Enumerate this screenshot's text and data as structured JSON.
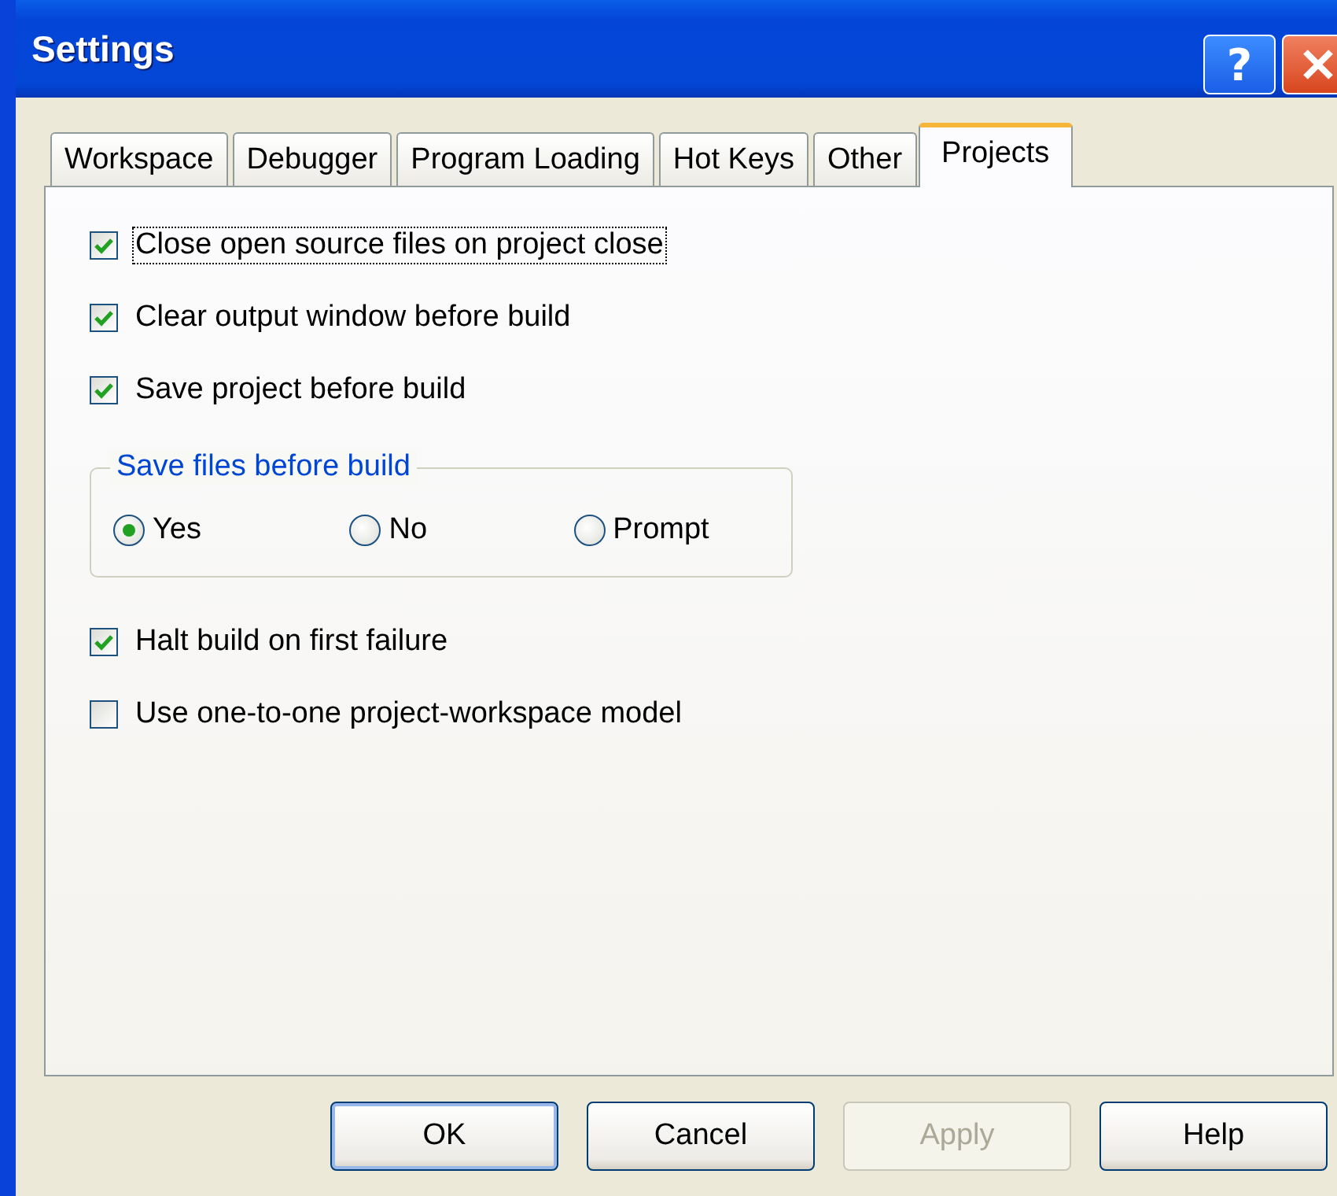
{
  "window": {
    "title": "Settings",
    "help_button": "?"
  },
  "tabs": [
    {
      "label": "Workspace",
      "selected": false
    },
    {
      "label": "Debugger",
      "selected": false
    },
    {
      "label": "Program Loading",
      "selected": false
    },
    {
      "label": "Hot Keys",
      "selected": false
    },
    {
      "label": "Other",
      "selected": false
    },
    {
      "label": "Projects",
      "selected": true
    }
  ],
  "options": [
    {
      "kind": "checkbox",
      "label": "Close open source files on project close",
      "checked": true,
      "focused": true
    },
    {
      "kind": "checkbox",
      "label": "Clear output window before build",
      "checked": true,
      "focused": false
    },
    {
      "kind": "checkbox",
      "label": "Save project before build",
      "checked": true,
      "focused": false
    },
    {
      "kind": "group",
      "title": "Save files before build",
      "choices": [
        {
          "label": "Yes",
          "selected": true
        },
        {
          "label": "No",
          "selected": false
        },
        {
          "label": "Prompt",
          "selected": false
        }
      ]
    },
    {
      "kind": "checkbox",
      "label": "Halt build on first failure",
      "checked": true,
      "focused": false
    },
    {
      "kind": "checkbox",
      "label": "Use one-to-one project-workspace model",
      "checked": false,
      "focused": false
    }
  ],
  "buttons": [
    {
      "label": "OK",
      "default": true,
      "disabled": false
    },
    {
      "label": "Cancel",
      "default": false,
      "disabled": false
    },
    {
      "label": "Apply",
      "default": false,
      "disabled": true
    },
    {
      "label": "Help",
      "default": false,
      "disabled": false
    }
  ]
}
